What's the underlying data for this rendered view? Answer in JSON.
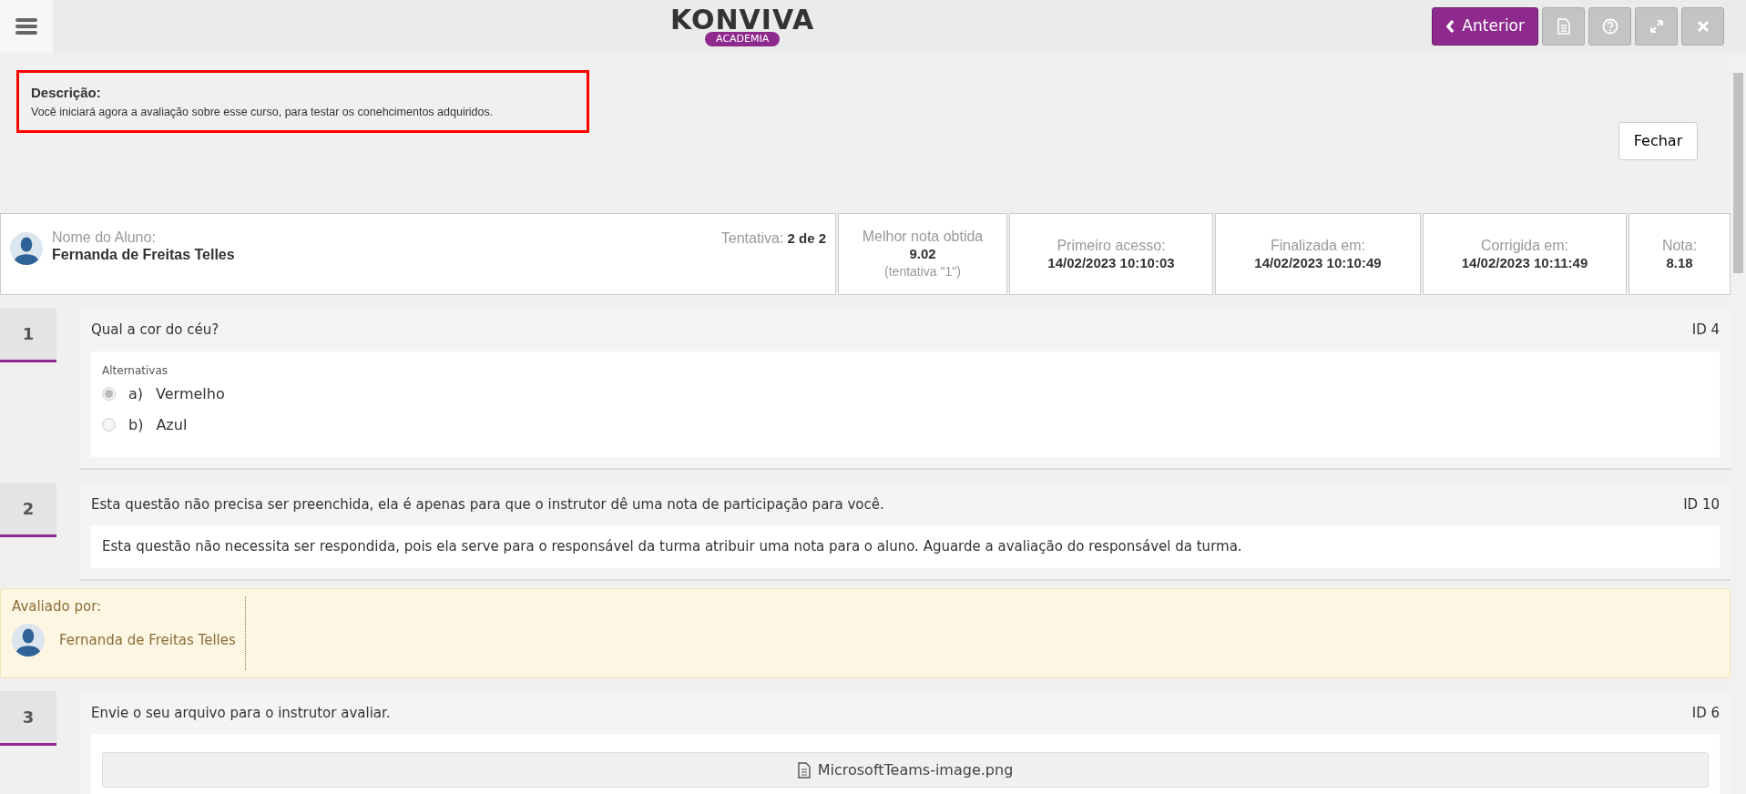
{
  "logo": {
    "wordmark": "KONVIVA",
    "tagline": "ACADEMIA"
  },
  "toolbar": {
    "back_button": "Anterior"
  },
  "description": {
    "label": "Descrição:",
    "text": "Você iniciará agora a avaliação sobre esse curso, para testar os conehcimentos adquiridos."
  },
  "close_button": "Fechar",
  "summary": {
    "student_label": "Nome do Aluno:",
    "student_name": "Fernanda de Freitas Telles",
    "attempt_label": "Tentativa:",
    "attempt_value": "2 de 2",
    "stats": [
      {
        "label": "Melhor nota obtida",
        "value": "9.02",
        "note": "(tentativa \"1\")"
      },
      {
        "label": "Primeiro acesso:",
        "value": "14/02/2023 10:10:03"
      },
      {
        "label": "Finalizada em:",
        "value": "14/02/2023 10:10:49"
      },
      {
        "label": "Corrigida em:",
        "value": "14/02/2023 10:11:49"
      },
      {
        "label": "Nota:",
        "value": "8.18"
      }
    ]
  },
  "questions": [
    {
      "number": "1",
      "text": "Qual a cor do céu?",
      "id": "ID 4",
      "kind": "choice",
      "options_label": "Alternativas",
      "options": [
        {
          "letter": "a)",
          "text": "Vermelho",
          "selected": true
        },
        {
          "letter": "b)",
          "text": "Azul",
          "selected": false
        }
      ]
    },
    {
      "number": "2",
      "text": "Esta questão não precisa ser preenchida, ela é apenas para que o instrutor dê uma nota de participação para você.",
      "id": "ID 10",
      "kind": "info",
      "answer": "Esta questão não necessita ser respondida, pois ela serve para o responsável da turma atribuir uma nota para o aluno. Aguarde a avaliação do responsável da turma.",
      "evaluated_by": {
        "label": "Avaliado por:",
        "name": "Fernanda de Freitas Telles"
      }
    },
    {
      "number": "3",
      "text": "Envie o seu arquivo para o instrutor avaliar.",
      "id": "ID 6",
      "kind": "file",
      "file": "MicrosoftTeams-image.png"
    }
  ]
}
